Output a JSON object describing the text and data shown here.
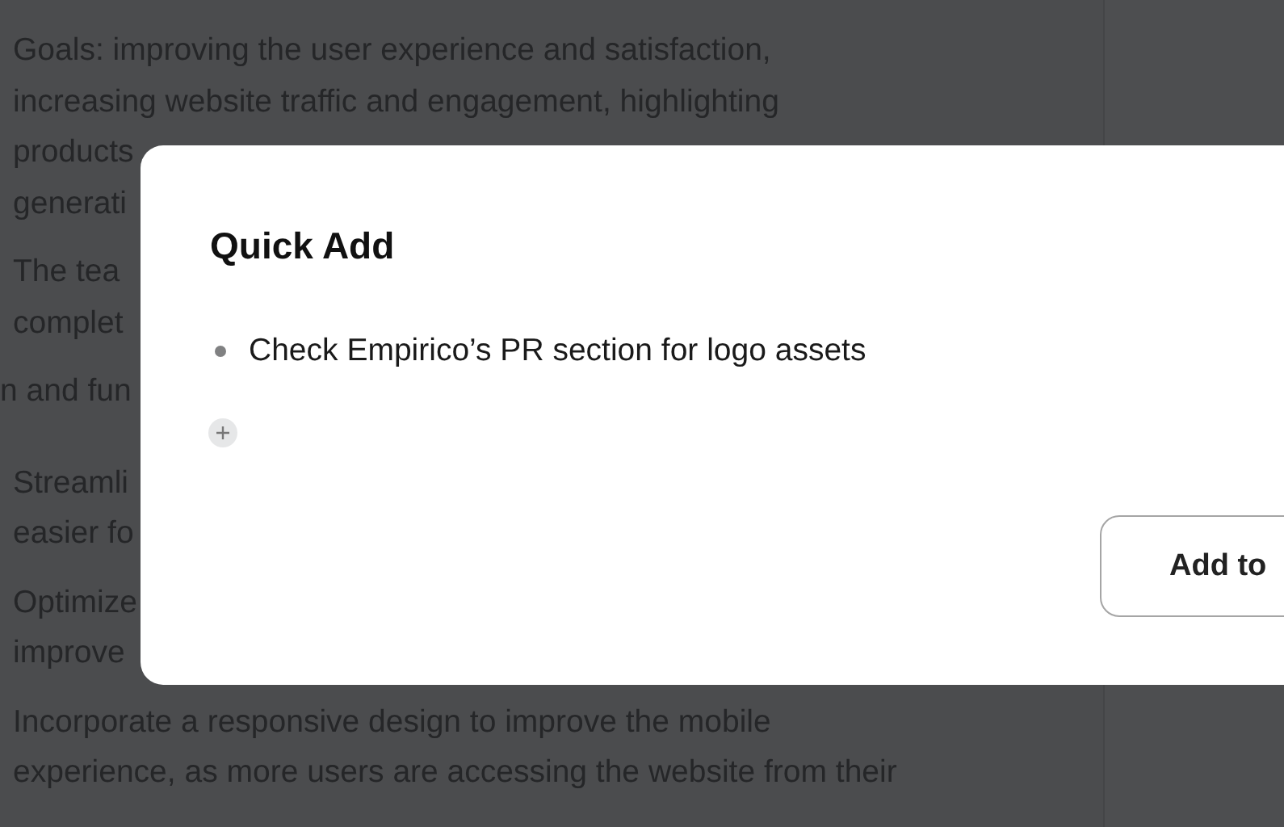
{
  "document": {
    "paragraphs": [
      {
        "lines": [
          "Goals: improving the user experience and satisfaction,",
          "increasing website traffic and engagement, highlighting",
          "products",
          "generati"
        ]
      },
      {
        "lines": [
          "The tea",
          "complet"
        ]
      },
      {
        "lines": [
          "n and fun"
        ]
      },
      {
        "lines": [
          "Streamli",
          "easier fo"
        ]
      },
      {
        "lines": [
          "Optimize",
          "improve"
        ]
      },
      {
        "lines": [
          "Incorporate a responsive design to improve the mobile",
          "experience, as more users are accessing the website from their"
        ]
      }
    ]
  },
  "dialog": {
    "title": "Quick Add",
    "items": [
      {
        "text": "Check Empirico’s PR section for logo assets"
      }
    ],
    "add_button": "Add to"
  }
}
